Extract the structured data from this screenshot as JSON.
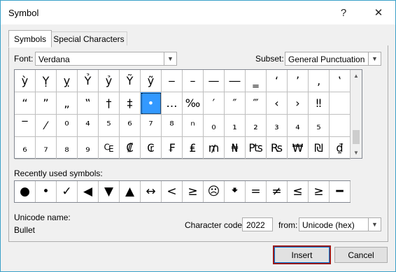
{
  "window": {
    "title": "Symbol",
    "help_glyph": "?",
    "close_glyph": "✕"
  },
  "tabs": [
    {
      "label": "Symbols",
      "active": true
    },
    {
      "label": "Special Characters",
      "active": false
    }
  ],
  "font": {
    "label": "Font:",
    "value": "Verdana"
  },
  "subset": {
    "label": "Subset:",
    "value": "General Punctuation"
  },
  "grid": {
    "rows": [
      [
        "ỳ",
        "Ỵ",
        "ỵ",
        "Ỷ",
        "ỷ",
        "Ỹ",
        "ỹ",
        "‒",
        "–",
        "—",
        "―",
        "‗",
        "‘",
        "’",
        "‚",
        "‛"
      ],
      [
        "“",
        "”",
        "„",
        "‟",
        "†",
        "‡",
        "•",
        "…",
        "‰",
        "′",
        "″",
        "‴",
        "‹",
        "›",
        "‼",
        " "
      ],
      [
        "‾",
        "⁄",
        "⁰",
        "⁴",
        "⁵",
        "⁶",
        "⁷",
        "⁸",
        "ⁿ",
        "₀",
        "₁",
        "₂",
        "₃",
        "₄",
        "₅",
        " "
      ],
      [
        "₆",
        "₇",
        "₈",
        "₉",
        "₠",
        "₡",
        "₢",
        "₣",
        "₤",
        "₥",
        "₦",
        "₧",
        "₨",
        "₩",
        "₪",
        "₫"
      ]
    ],
    "selected": {
      "row": 1,
      "col": 6
    }
  },
  "recent": {
    "label": "Recently used symbols:",
    "symbols": [
      "●",
      "•",
      "✓",
      "◀",
      "▼",
      "▲",
      "↔",
      "<",
      "≥",
      "☹",
      "🠻",
      "=",
      "≠",
      "≤",
      "≥",
      "━"
    ]
  },
  "unicode_name": {
    "label": "Unicode name:",
    "value": "Bullet"
  },
  "character_code": {
    "label": "Character code:",
    "value": "2022"
  },
  "from": {
    "label": "from:",
    "value": "Unicode (hex)"
  },
  "buttons": {
    "insert": "Insert",
    "cancel": "Cancel"
  },
  "colors": {
    "selection": "#3399ff",
    "window_border": "#3aa0c8",
    "default_button_ring": "#9b1b1b"
  }
}
